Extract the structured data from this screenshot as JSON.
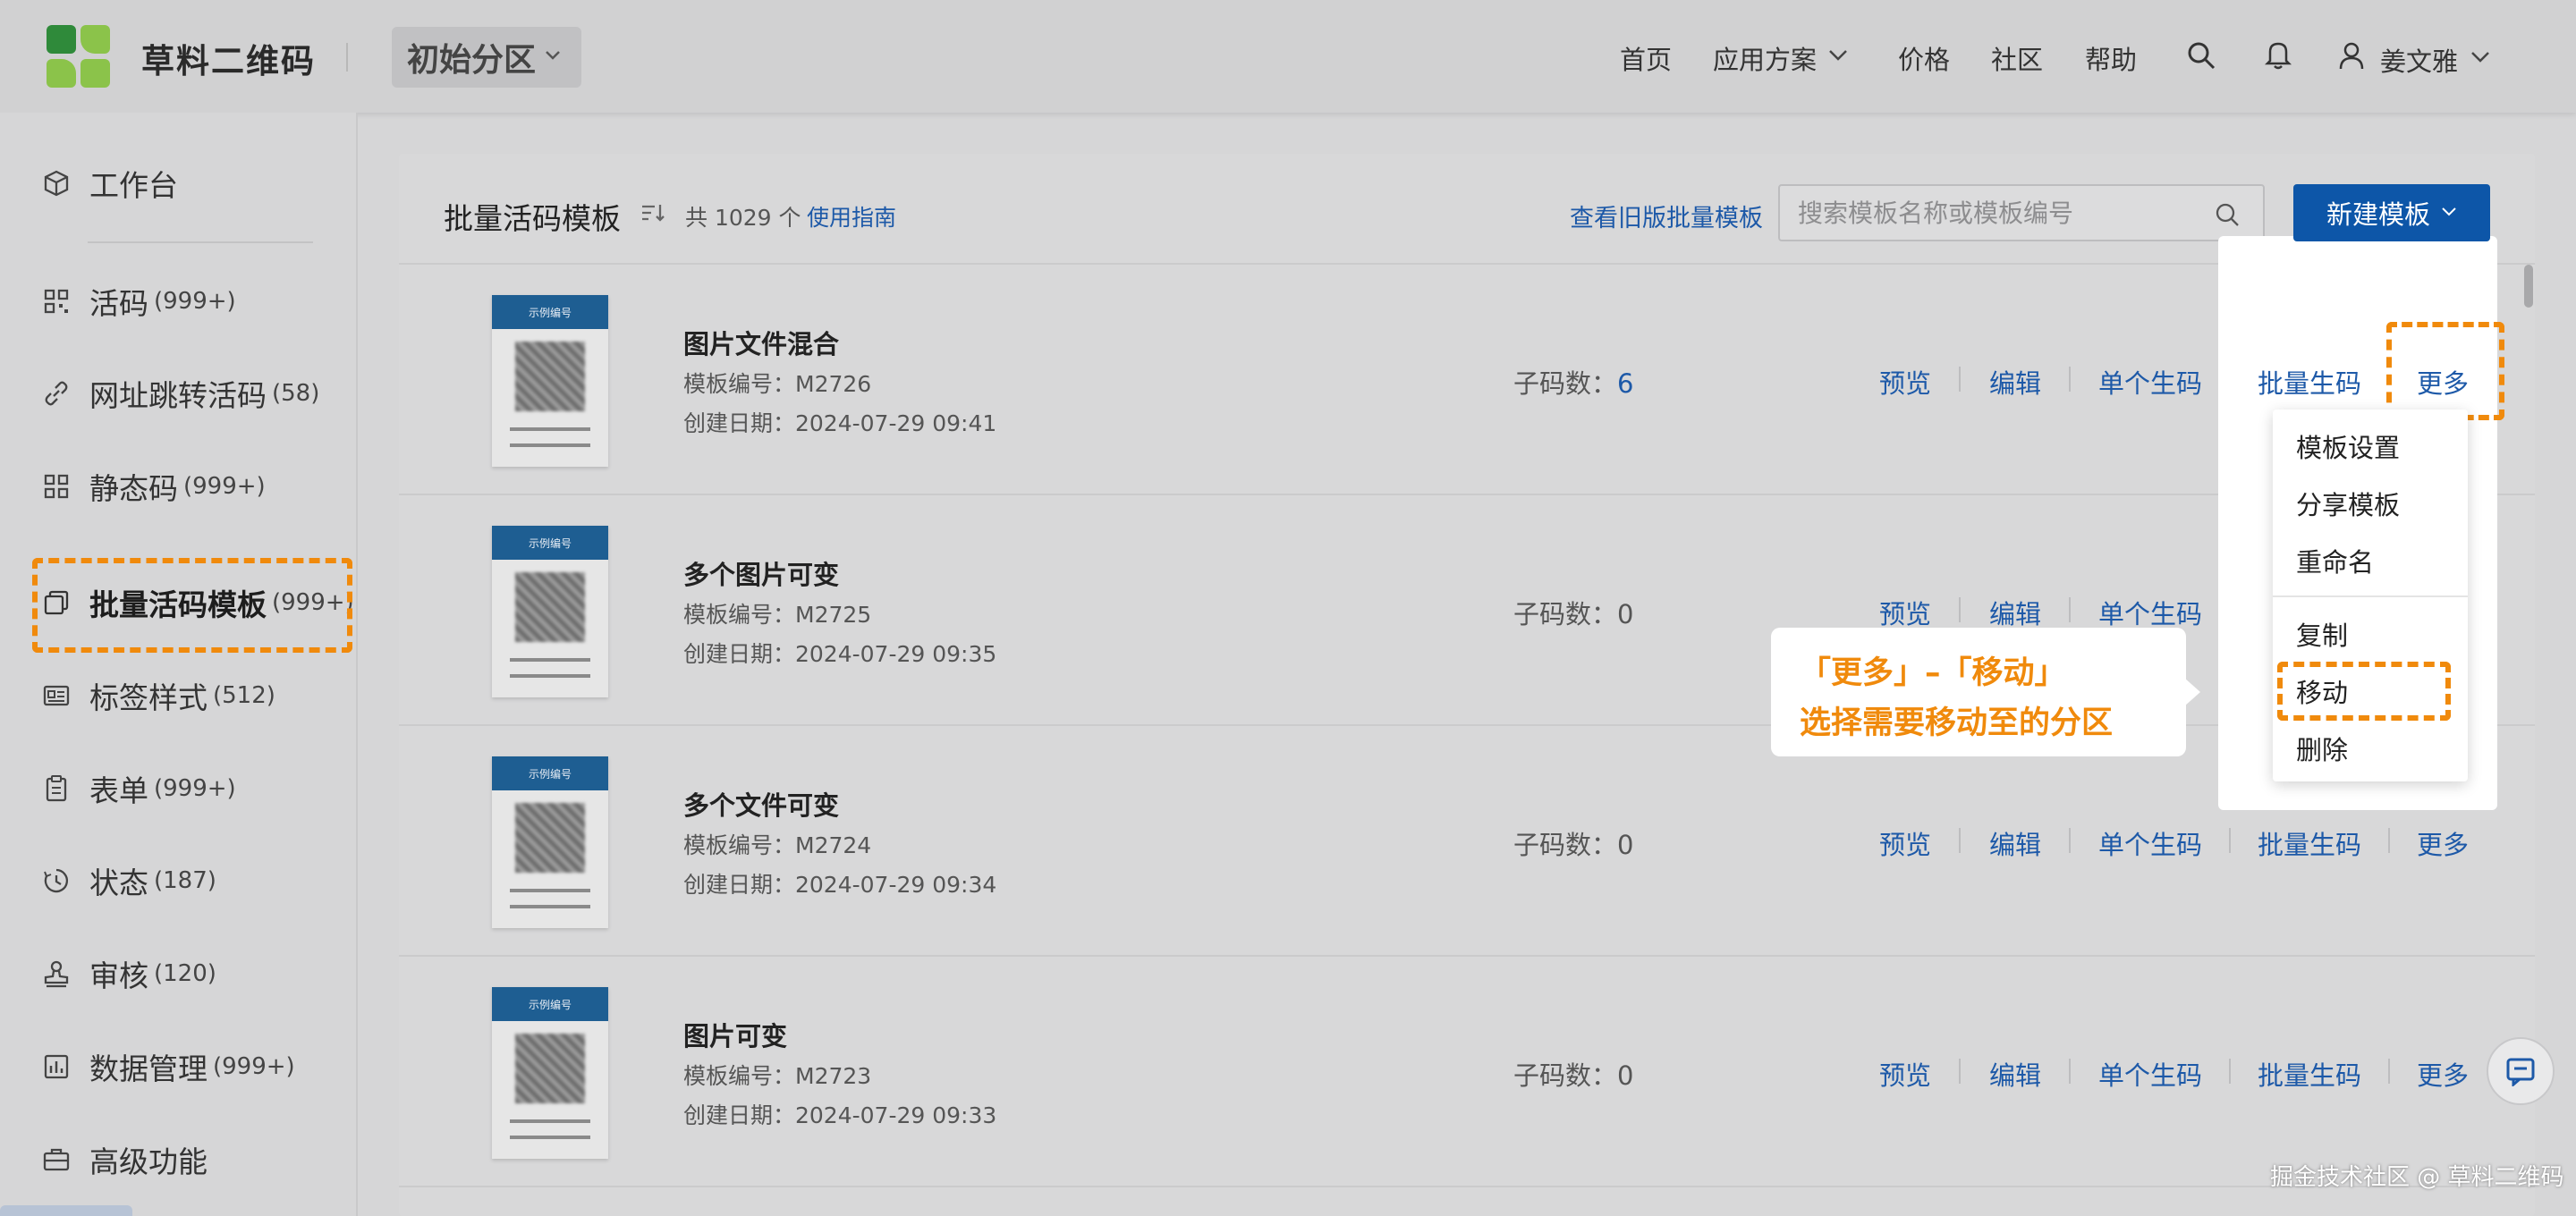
{
  "header": {
    "brand": "草料二维码",
    "partition": "初始分区",
    "nav": [
      "首页",
      "应用方案",
      "价格",
      "社区",
      "帮助"
    ],
    "user": "姜文雅"
  },
  "sidebar": {
    "items": [
      {
        "label": "工作台",
        "count": "",
        "icon": "cube-icon"
      },
      {
        "label": "活码",
        "count": "(999+)",
        "icon": "qr-grid-icon"
      },
      {
        "label": "网址跳转活码",
        "count": "(58)",
        "icon": "link-icon"
      },
      {
        "label": "静态码",
        "count": "(999+)",
        "icon": "qr-static-icon"
      },
      {
        "label": "批量活码模板",
        "count": "(999+)",
        "icon": "template-stack-icon"
      },
      {
        "label": "标签样式",
        "count": "(512)",
        "icon": "label-card-icon"
      },
      {
        "label": "表单",
        "count": "(999+)",
        "icon": "clipboard-icon"
      },
      {
        "label": "状态",
        "count": "(187)",
        "icon": "status-clock-icon"
      },
      {
        "label": "审核",
        "count": "(120)",
        "icon": "stamp-icon"
      },
      {
        "label": "数据管理",
        "count": "(999+)",
        "icon": "bar-chart-icon"
      },
      {
        "label": "高级功能",
        "count": "",
        "icon": "briefcase-icon"
      }
    ],
    "active_index": 4
  },
  "main": {
    "title": "批量活码模板",
    "total": "共 1029 个",
    "guide": "使用指南",
    "old_link": "查看旧版批量模板",
    "search_placeholder": "搜索模板名称或模板编号",
    "new_button": "新建模板",
    "thumb_header": "示例编号",
    "sub_label": "子码数：",
    "actions": [
      "预览",
      "编辑",
      "单个生码",
      "批量生码",
      "更多"
    ],
    "rows": [
      {
        "name": "图片文件混合",
        "code": "模板编号：M2726",
        "date": "创建日期：2024-07-29 09:41",
        "sub": "6"
      },
      {
        "name": "多个图片可变",
        "code": "模板编号：M2725",
        "date": "创建日期：2024-07-29 09:35",
        "sub": "0"
      },
      {
        "name": "多个文件可变",
        "code": "模板编号：M2724",
        "date": "创建日期：2024-07-29 09:34",
        "sub": "0"
      },
      {
        "name": "图片可变",
        "code": "模板编号：M2723",
        "date": "创建日期：2024-07-29 09:33",
        "sub": "0"
      }
    ]
  },
  "dropdown": {
    "items": [
      "模板设置",
      "分享模板",
      "重命名",
      "复制",
      "移动",
      "删除"
    ]
  },
  "callout": {
    "line1": "「更多」–「移动」",
    "line2": "选择需要移动至的分区"
  },
  "watermark": "掘金技术社区 @ 草料二维码",
  "colors": {
    "brand_blue": "#1d59a8",
    "primary_button": "#0d56a8",
    "highlight_orange": "#f08a0c",
    "logo_green_dark": "#2f8a3a",
    "logo_green_light": "#8bc34a"
  }
}
